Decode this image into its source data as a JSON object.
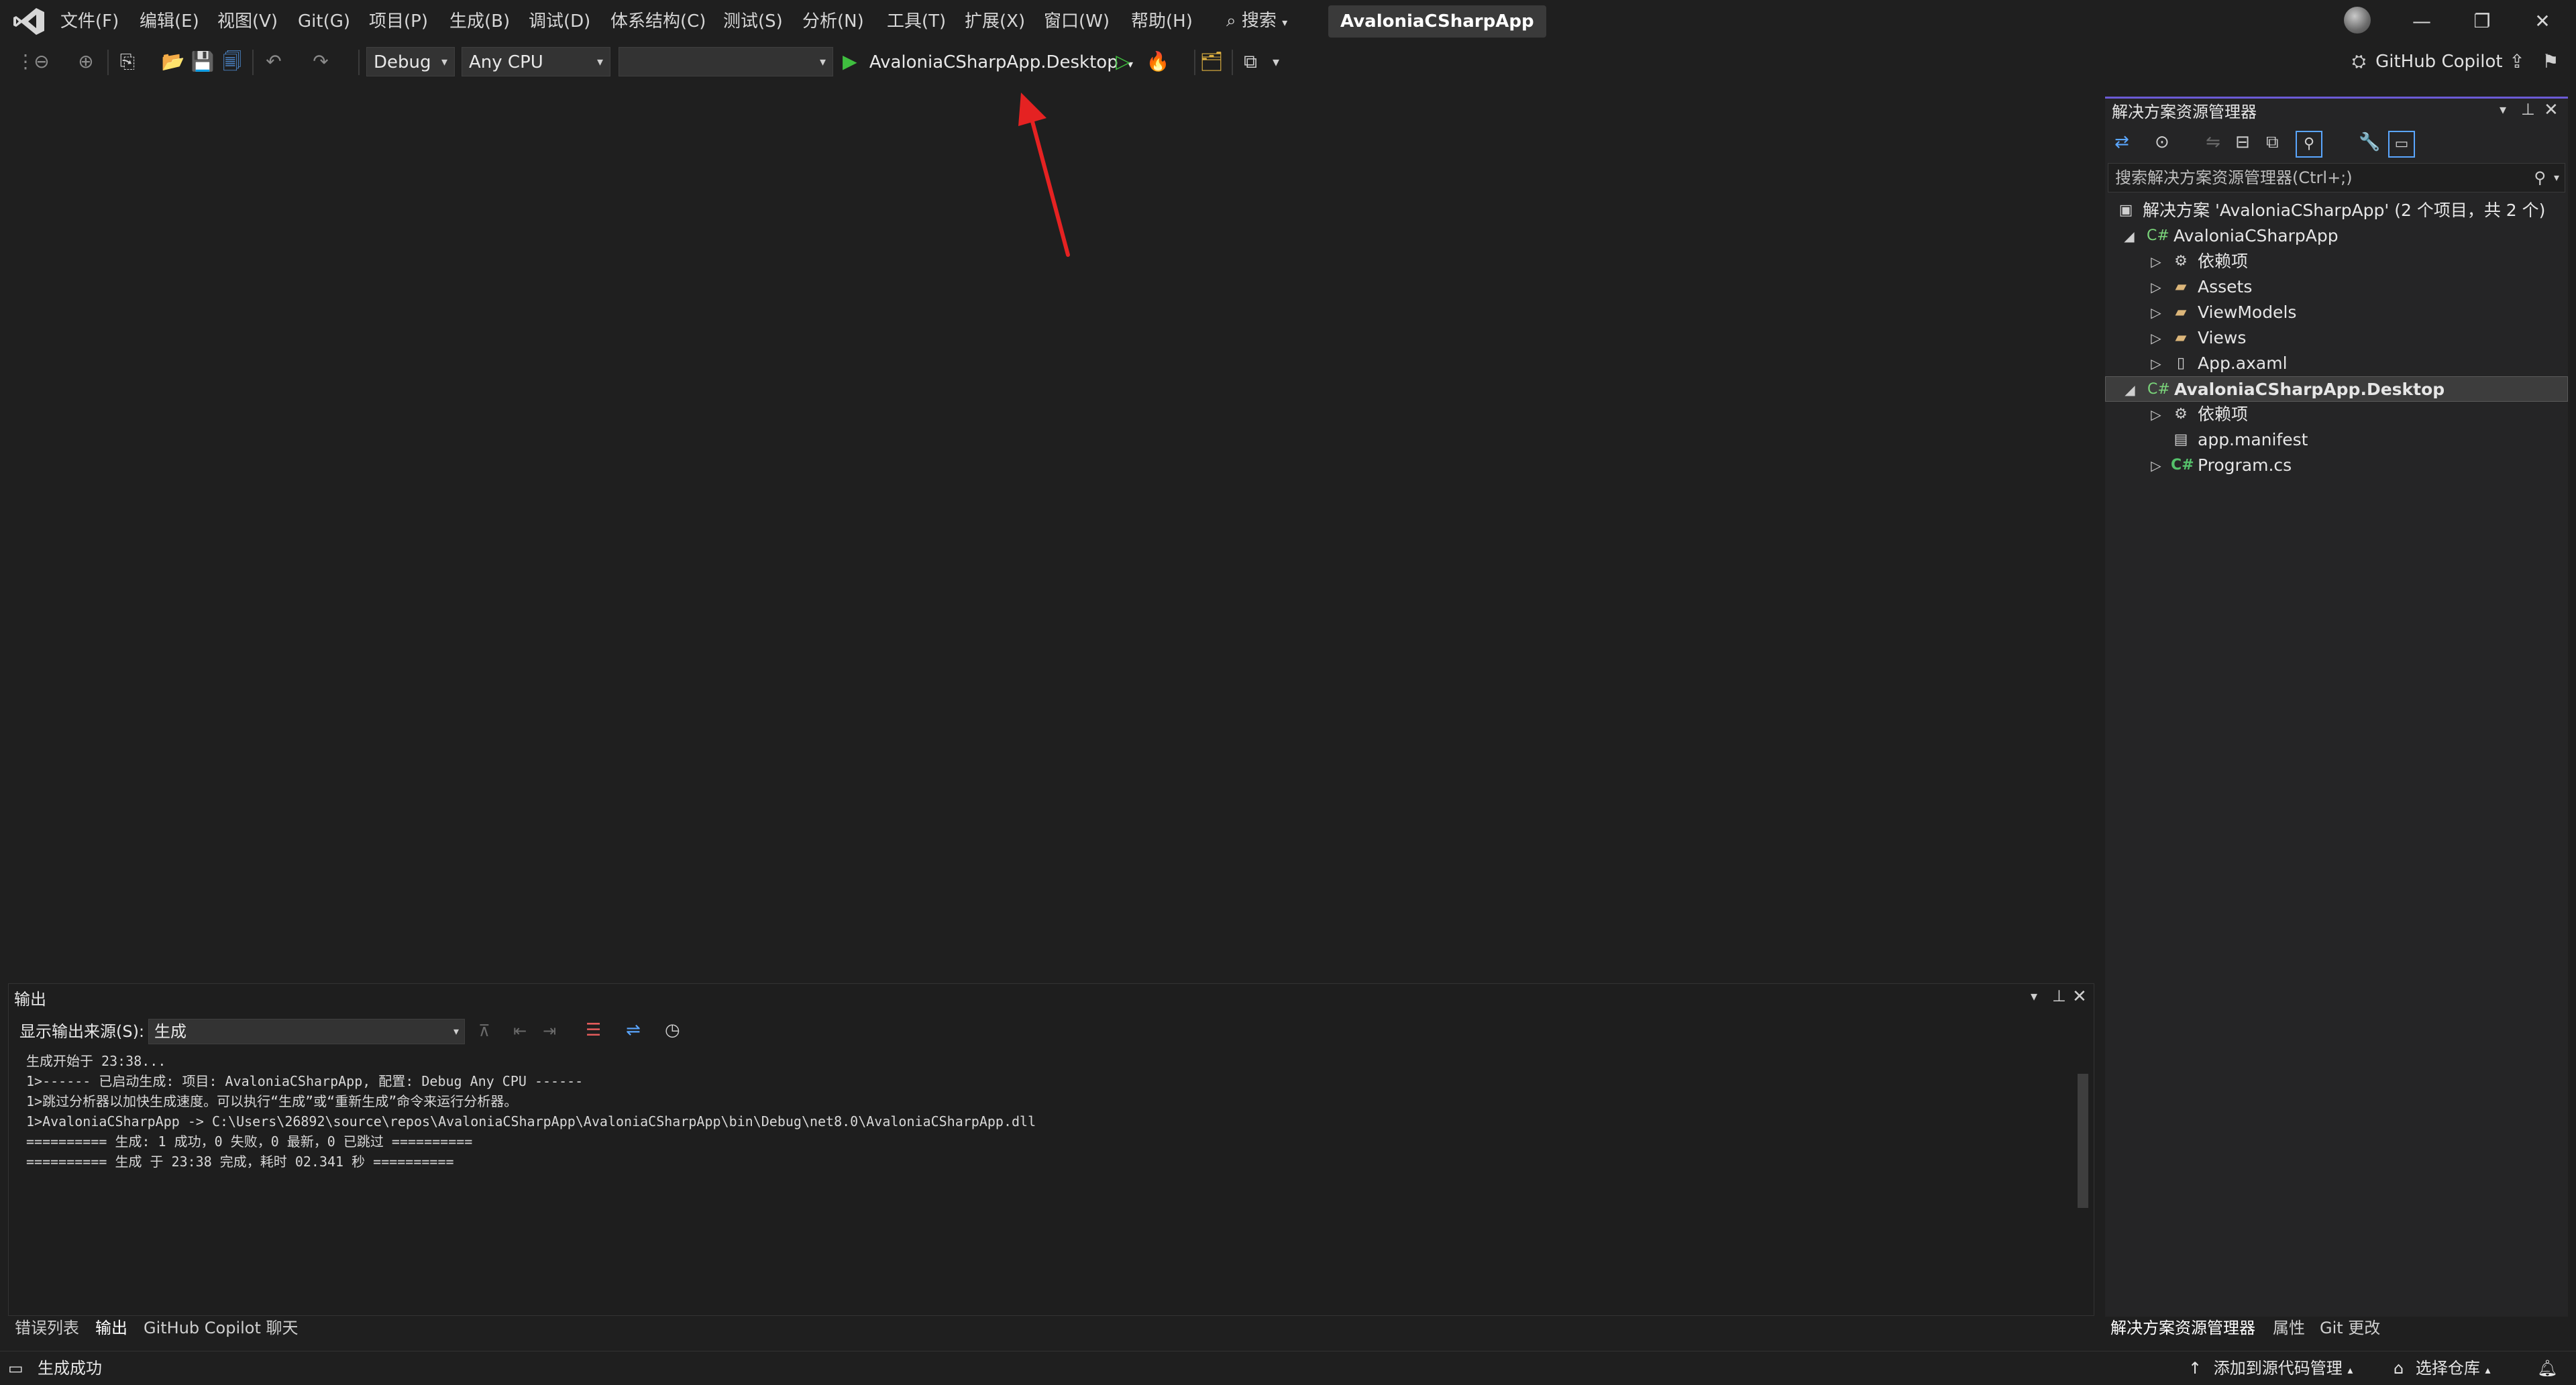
{
  "menu": {
    "items": [
      "文件(F)",
      "编辑(E)",
      "视图(V)",
      "Git(G)",
      "项目(P)",
      "生成(B)",
      "调试(D)",
      "体系结构(C)",
      "测试(S)",
      "分析(N)",
      "工具(T)",
      "扩展(X)",
      "窗口(W)",
      "帮助(H)"
    ],
    "search_label": "搜索",
    "app_title": "AvaloniaCSharpApp"
  },
  "toolbar": {
    "config": "Debug",
    "platform": "Any CPU",
    "startup_empty": "",
    "run_target": "AvaloniaCSharpApp.Desktop",
    "copilot": "GitHub Copilot"
  },
  "solution_explorer": {
    "title": "解决方案资源管理器",
    "search_placeholder": "搜索解决方案资源管理器(Ctrl+;)",
    "tree": [
      {
        "label": "解决方案 'AvaloniaCSharpApp' (2 个项目，共 2 个)",
        "icon": "solution-icon",
        "level": 0,
        "expander": ""
      },
      {
        "label": "AvaloniaCSharpApp",
        "icon": "csharp-project-icon",
        "level": 1,
        "expander": "◢"
      },
      {
        "label": "依赖项",
        "icon": "dependencies-icon",
        "level": 2,
        "expander": "▷"
      },
      {
        "label": "Assets",
        "icon": "folder-icon",
        "level": 2,
        "expander": "▷"
      },
      {
        "label": "ViewModels",
        "icon": "folder-icon",
        "level": 2,
        "expander": "▷"
      },
      {
        "label": "Views",
        "icon": "folder-icon",
        "level": 2,
        "expander": "▷"
      },
      {
        "label": "App.axaml",
        "icon": "file-icon",
        "level": 2,
        "expander": "▷"
      },
      {
        "label": "AvaloniaCSharpApp.Desktop",
        "icon": "csharp-project-icon",
        "level": 1,
        "expander": "◢",
        "selected": true
      },
      {
        "label": "依赖项",
        "icon": "dependencies-icon",
        "level": 2,
        "expander": "▷"
      },
      {
        "label": "app.manifest",
        "icon": "manifest-icon",
        "level": 2,
        "expander": ""
      },
      {
        "label": "Program.cs",
        "icon": "csharp-file-icon",
        "level": 2,
        "expander": "▷"
      }
    ]
  },
  "output": {
    "title": "输出",
    "source_label": "显示输出来源(S):",
    "source_value": "生成",
    "lines": [
      "生成开始于 23:38...",
      "1>------ 已启动生成: 项目: AvaloniaCSharpApp, 配置: Debug Any CPU ------",
      "1>跳过分析器以加快生成速度。可以执行“生成”或“重新生成”命令来运行分析器。",
      "1>AvaloniaCSharpApp -> C:\\Users\\26892\\source\\repos\\AvaloniaCSharpApp\\AvaloniaCSharpApp\\bin\\Debug\\net8.0\\AvaloniaCSharpApp.dll",
      "========== 生成: 1 成功，0 失败，0 最新，0 已跳过 ==========",
      "========== 生成 于 23:38 完成，耗时 02.341 秒 =========="
    ]
  },
  "bottom_tabs_left": [
    "错误列表",
    "输出",
    "GitHub Copilot 聊天"
  ],
  "bottom_tabs_right": [
    "解决方案资源管理器",
    "属性",
    "Git 更改"
  ],
  "status": {
    "message": "生成成功",
    "add_source_control": "添加到源代码管理",
    "select_repo": "选择仓库"
  }
}
